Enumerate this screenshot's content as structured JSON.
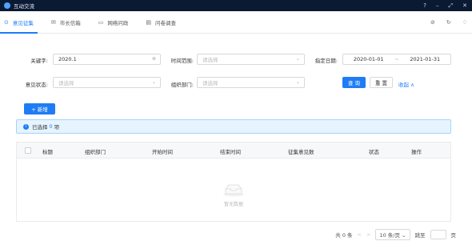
{
  "window": {
    "title": "互动交流"
  },
  "tabs": [
    {
      "label": "意见征集",
      "icon": "globe-icon"
    },
    {
      "label": "市长信箱",
      "icon": "mail-icon"
    },
    {
      "label": "网络问政",
      "icon": "monitor-icon"
    },
    {
      "label": "问卷调查",
      "icon": "clipboard-icon"
    }
  ],
  "filters": {
    "keyword_label": "关键字:",
    "keyword_value": "2020.1",
    "time_range_label": "时间范围:",
    "time_range_placeholder": "请选择",
    "date_label": "指定日期:",
    "date_start": "2020-01-01",
    "date_sep": "~",
    "date_end": "2021-01-31",
    "status_label": "意见状态:",
    "status_placeholder": "请选择",
    "org_label": "组织部门:",
    "org_placeholder": "请选择",
    "query_button": "查 询",
    "reset_button": "重 置",
    "collapse_link": "收起 ∧"
  },
  "add_button": "+ 新增",
  "selection": {
    "prefix": "已选择",
    "count": "0",
    "suffix": "项"
  },
  "table": {
    "columns": [
      "标题",
      "组织部门",
      "开始时间",
      "结束时间",
      "征集意见数",
      "状态",
      "操作"
    ],
    "empty_text": "暂无数据"
  },
  "pagination": {
    "total": "共 0 条",
    "prev": "<",
    "next": ">",
    "page_size": "10 条/页",
    "goto_label": "跳至",
    "page_suffix": "页"
  },
  "colors": {
    "accent": "#1f7cf5",
    "titlebar": "#0b1a33",
    "alert_bg": "#e6f4ff"
  }
}
